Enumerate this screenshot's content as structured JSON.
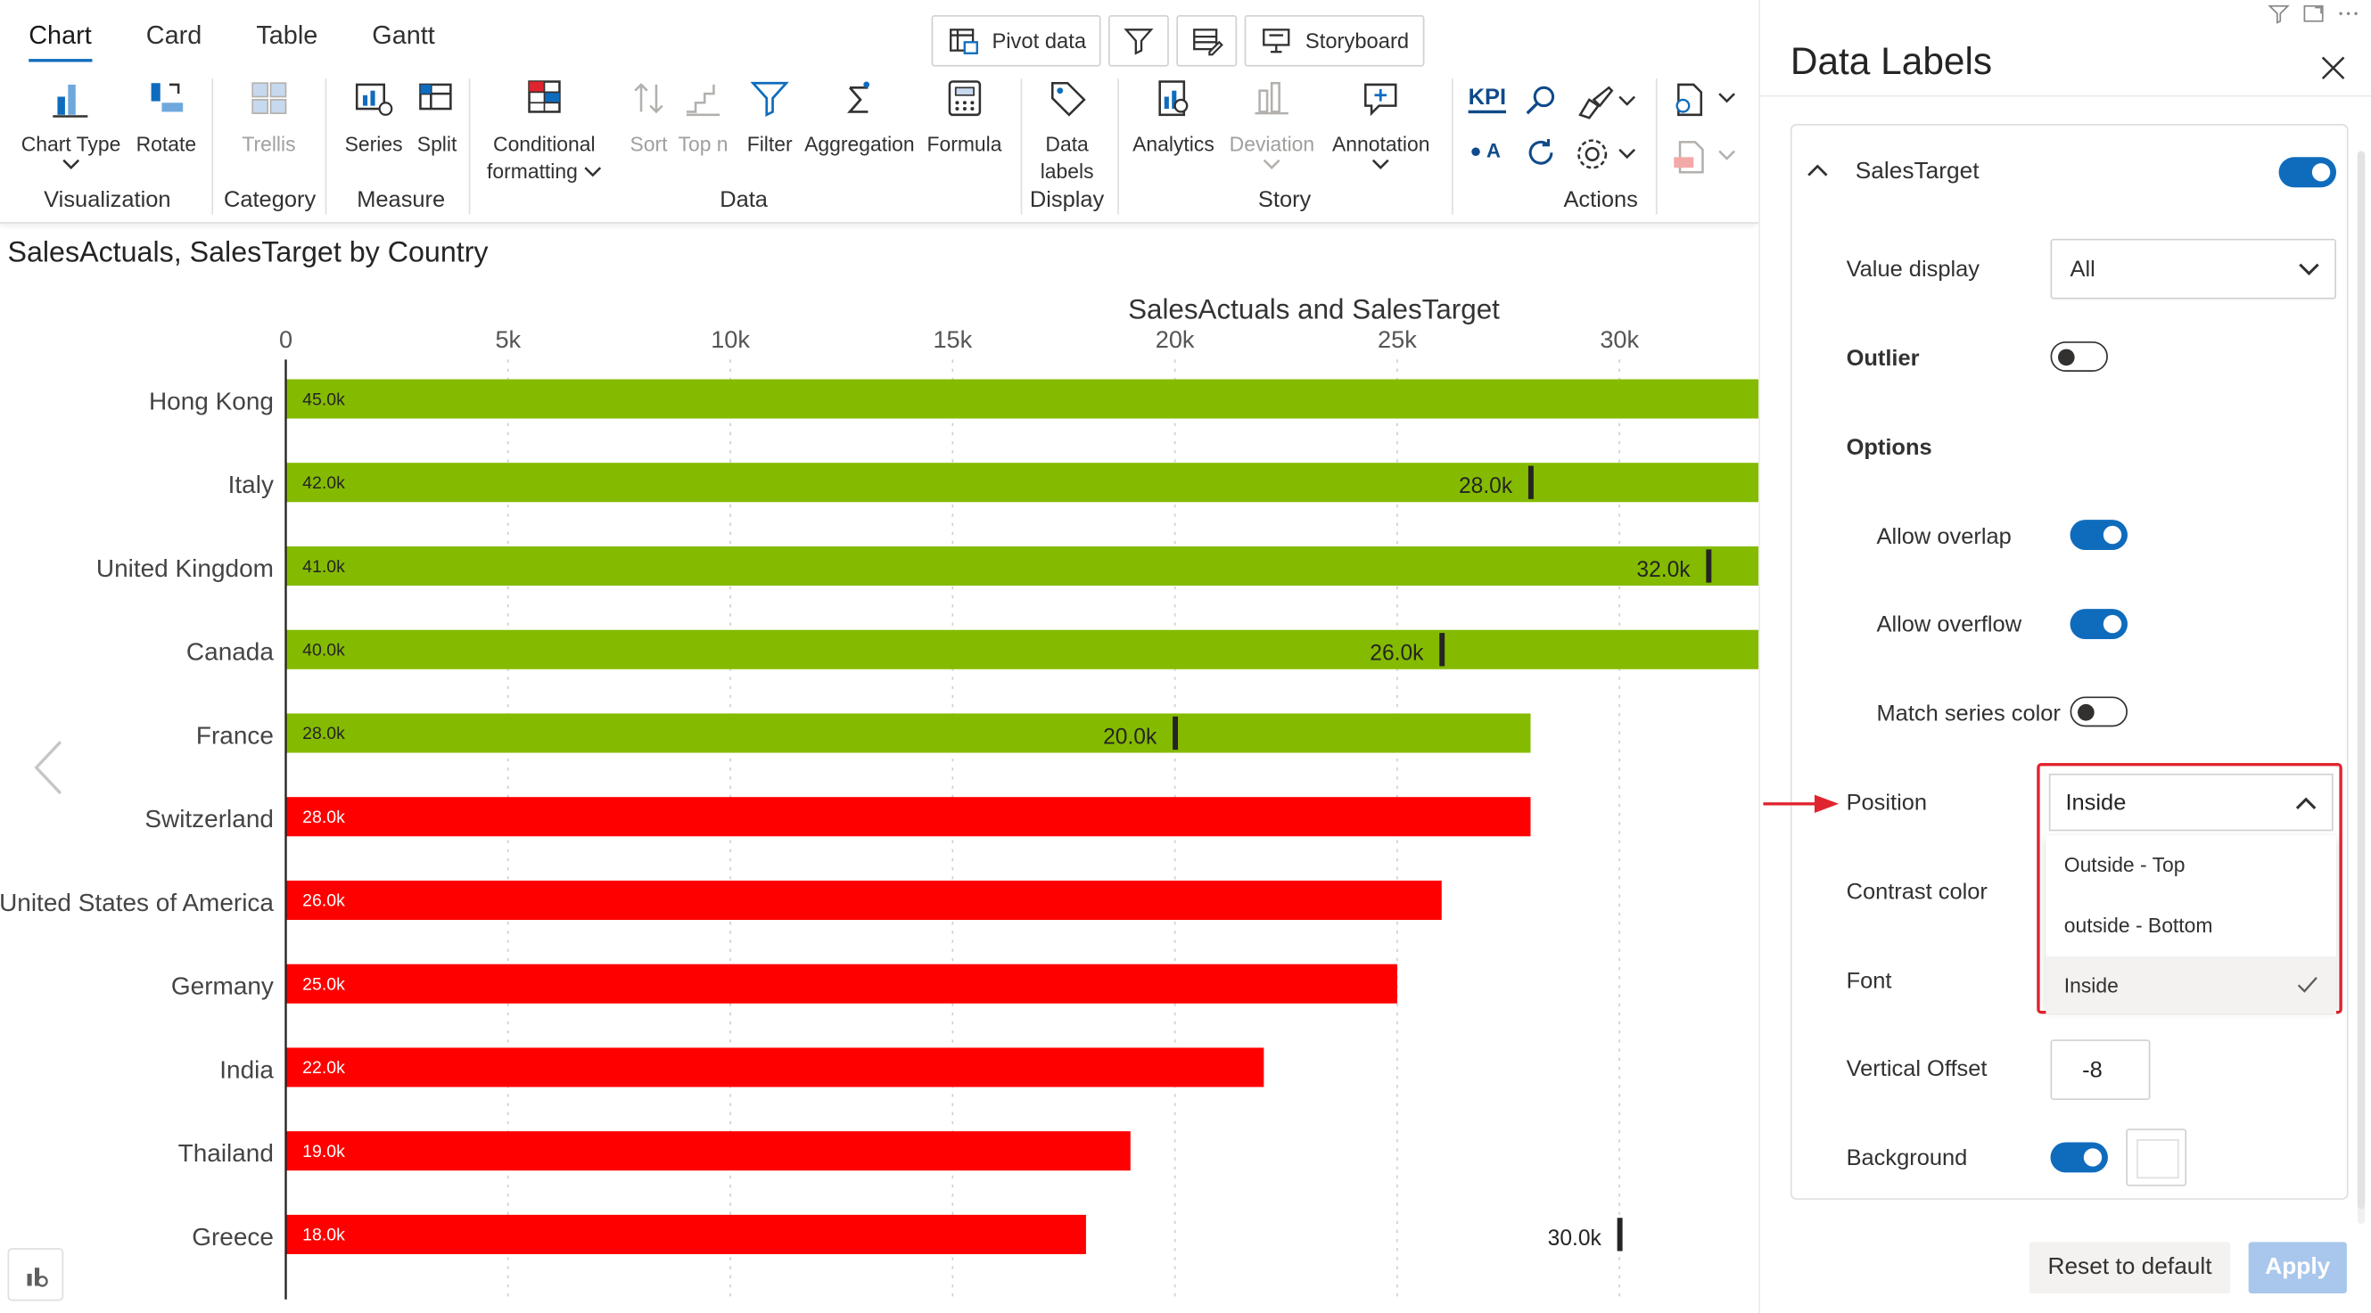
{
  "tabs": [
    {
      "label": "Chart",
      "active": true
    },
    {
      "label": "Card"
    },
    {
      "label": "Table"
    },
    {
      "label": "Gantt"
    }
  ],
  "top_buttons": {
    "pivot": "Pivot data",
    "storyboard": "Storyboard"
  },
  "ribbon": {
    "items": {
      "chart_type": "Chart Type",
      "rotate": "Rotate",
      "trellis": "Trellis",
      "series": "Series",
      "split": "Split",
      "conditional_1": "Conditional",
      "conditional_2": "formatting",
      "sort": "Sort",
      "topn": "Top n",
      "filter": "Filter",
      "aggregation": "Aggregation",
      "formula": "Formula",
      "data_labels_1": "Data",
      "data_labels_2": "labels",
      "analytics": "Analytics",
      "deviation": "Deviation",
      "annotation": "Annotation",
      "kpi": "KPI",
      "oa": "A"
    },
    "groups": {
      "visualization": "Visualization",
      "category": "Category",
      "measure": "Measure",
      "data": "Data",
      "display": "Display",
      "story": "Story",
      "actions": "Actions"
    }
  },
  "chart": {
    "title": "SalesActuals, SalesTarget by Country",
    "axis_title": "SalesActuals and SalesTarget",
    "colors": {
      "above": "#84bb00",
      "below": "#ff0000",
      "target": "#252423",
      "grid": "#d0d0d0"
    }
  },
  "chart_data": {
    "type": "bar",
    "orientation": "horizontal",
    "title": "SalesActuals, SalesTarget by Country",
    "xlabel": "SalesActuals and SalesTarget",
    "xlim": [
      0,
      33000
    ],
    "x_ticks": [
      "0",
      "5k",
      "10k",
      "15k",
      "20k",
      "25k",
      "30k"
    ],
    "x_tick_values": [
      0,
      5000,
      10000,
      15000,
      20000,
      25000,
      30000
    ],
    "categories": [
      "Hong Kong",
      "Italy",
      "United Kingdom",
      "Canada",
      "France",
      "Switzerland",
      "United States of America",
      "Germany",
      "India",
      "Thailand",
      "Greece"
    ],
    "series": [
      {
        "name": "SalesActuals",
        "values": [
          45000,
          42000,
          41000,
          40000,
          28000,
          28000,
          26000,
          25000,
          22000,
          19000,
          18000
        ],
        "labels": [
          "45.0k",
          "42.0k",
          "41.0k",
          "40.0k",
          "28.0k",
          "28.0k",
          "26.0k",
          "25.0k",
          "22.0k",
          "19.0k",
          "18.0k"
        ],
        "status": [
          "above",
          "above",
          "above",
          "above",
          "above",
          "below",
          "below",
          "below",
          "below",
          "below",
          "below"
        ]
      },
      {
        "name": "SalesTarget",
        "values": [
          null,
          28000,
          32000,
          26000,
          20000,
          null,
          null,
          null,
          null,
          null,
          30000
        ],
        "labels": [
          "",
          "28.0k",
          "32.0k",
          "26.0k",
          "20.0k",
          "",
          "",
          "",
          "",
          "",
          "30.0k"
        ]
      }
    ],
    "grid": true
  },
  "panel": {
    "title": "Data Labels",
    "section": "SalesTarget",
    "section_enabled": true,
    "value_display_label": "Value display",
    "value_display": "All",
    "outlier_label": "Outlier",
    "outlier": false,
    "options_label": "Options",
    "allow_overlap_label": "Allow overlap",
    "allow_overlap": true,
    "allow_overflow_label": "Allow overflow",
    "allow_overflow": true,
    "match_series_label": "Match series color",
    "match_series": false,
    "position_label": "Position",
    "position_value": "Inside",
    "position_options": [
      "Outside - Top",
      "outside - Bottom",
      "Inside"
    ],
    "contrast_label": "Contrast color",
    "font_label": "Font",
    "vertical_offset_label": "Vertical Offset",
    "vertical_offset": "-8",
    "background_label": "Background",
    "background": true,
    "reset_label": "Reset to default",
    "apply_label": "Apply"
  }
}
